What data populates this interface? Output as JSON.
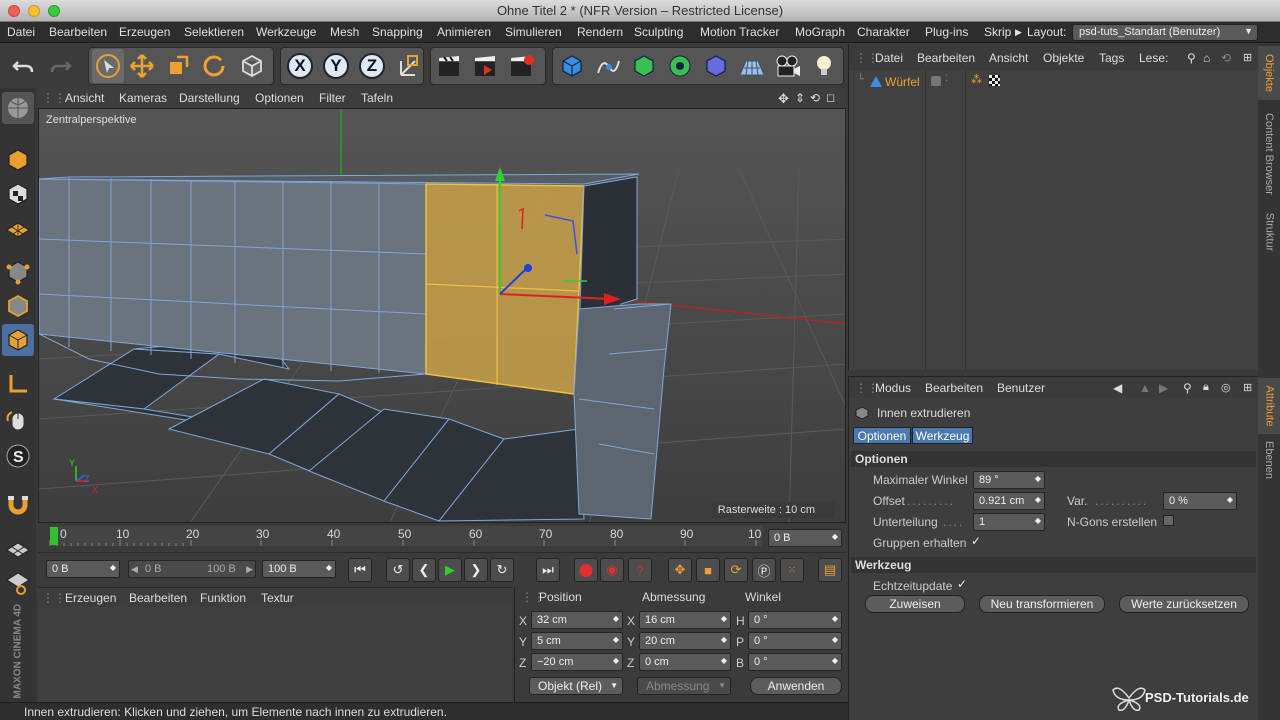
{
  "window": {
    "title": "Ohne Titel 2 * (NFR Version – Restricted License)"
  },
  "menubar": {
    "items": [
      "Datei",
      "Bearbeiten",
      "Erzeugen",
      "Selektieren",
      "Werkzeuge",
      "Mesh",
      "Snapping",
      "Animieren",
      "Simulieren",
      "Rendern",
      "Sculpting",
      "Motion Tracker",
      "MoGraph",
      "Charakter",
      "Plug-ins",
      "Skrip"
    ],
    "layout_label": "Layout:",
    "layout_value": "psd-tuts_Standart (Benutzer)"
  },
  "toolbar": {
    "axis_x": "X",
    "axis_y": "Y",
    "axis_z": "Z"
  },
  "viewport": {
    "menu": [
      "Ansicht",
      "Kameras",
      "Darstellung",
      "Optionen",
      "Filter",
      "Tafeln"
    ],
    "camera_label": "Zentralperspektive",
    "grid_info": "Rasterweite : 10 cm",
    "axis_labels": {
      "y": "Y",
      "z": "Z",
      "x": "X"
    }
  },
  "timeline": {
    "ticks": [
      "0",
      "10",
      "20",
      "30",
      "40",
      "50",
      "60",
      "70",
      "80",
      "90",
      "100"
    ],
    "current_frame": "0 B"
  },
  "anim": {
    "start": "0 B",
    "range_start": "0 B",
    "range_end": "100 B",
    "end": "100 B"
  },
  "material_panel": {
    "menu": [
      "Erzeugen",
      "Bearbeiten",
      "Funktion",
      "Textur"
    ]
  },
  "coordinates": {
    "headers": {
      "position": "Position",
      "size": "Abmessung",
      "rotation": "Winkel"
    },
    "rows": [
      {
        "axis": "X",
        "pos": "32 cm",
        "size_axis": "X",
        "size": "16 cm",
        "rot_axis": "H",
        "rot": "0 °"
      },
      {
        "axis": "Y",
        "pos": "5 cm",
        "size_axis": "Y",
        "size": "20 cm",
        "rot_axis": "P",
        "rot": "0 °"
      },
      {
        "axis": "Z",
        "pos": "−20 cm",
        "size_axis": "Z",
        "size": "0 cm",
        "rot_axis": "B",
        "rot": "0 °"
      }
    ],
    "mode_select": "Objekt (Rel)",
    "size_select": "Abmessung",
    "apply_button": "Anwenden"
  },
  "object_manager": {
    "menu": [
      "Datei",
      "Bearbeiten",
      "Ansicht",
      "Objekte",
      "Tags",
      "Lese:"
    ],
    "object_name": "Würfel"
  },
  "attribute_manager": {
    "menu": [
      "Modus",
      "Bearbeiten",
      "Benutzer"
    ],
    "tool_name": "Innen extrudieren",
    "tabs": [
      "Optionen",
      "Werkzeug"
    ],
    "section_options": "Optionen",
    "max_angle_label": "Maximaler Winkel",
    "max_angle_value": "89 °",
    "offset_label": "Offset",
    "offset_value": "0.921 cm",
    "var_label": "Var.",
    "var_value": "0 %",
    "subdiv_label": "Unterteilung",
    "subdiv_value": "1",
    "ngons_label": "N-Gons erstellen",
    "keep_groups_label": "Gruppen erhalten",
    "section_tool": "Werkzeug",
    "realtime_label": "Echtzeitupdate",
    "btn_assign": "Zuweisen",
    "btn_retransform": "Neu transformieren",
    "btn_reset": "Werte zurücksetzen"
  },
  "right_tabs": [
    "Objekte",
    "Content Browser",
    "Struktur",
    "Attribute",
    "Ebenen"
  ],
  "status": {
    "text": "Innen extrudieren: Klicken und ziehen, um Elemente nach innen zu extrudieren."
  },
  "brand": {
    "maxon": "MAXON CINEMA 4D",
    "watermark": "PSD-Tutorials.de"
  },
  "colors": {
    "accent_orange": "#f0a030",
    "selection": "#e8b040",
    "axis_x": "#e02020",
    "axis_y": "#20c020",
    "axis_z": "#3060e0"
  }
}
